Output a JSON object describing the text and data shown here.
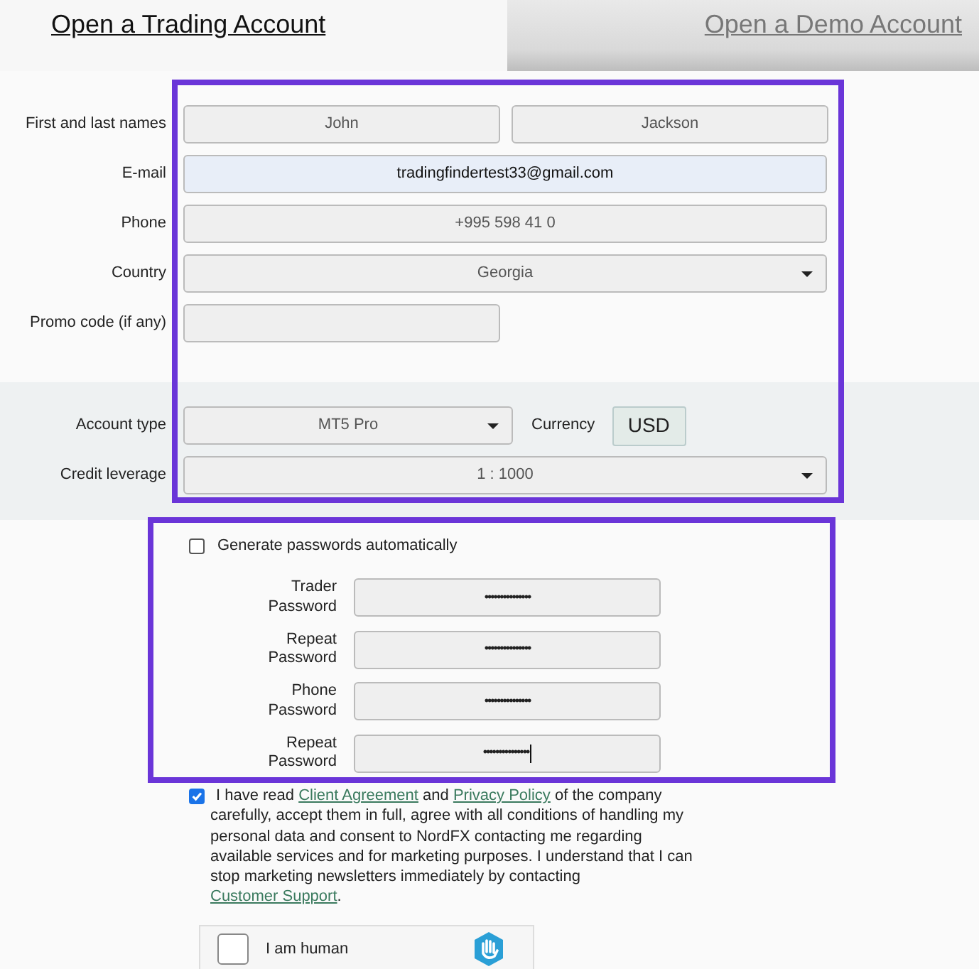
{
  "tabs": [
    {
      "label": "Open a Trading Account",
      "selected": true
    },
    {
      "label": "Open a Demo Account",
      "selected": false
    }
  ],
  "personal_fields": [
    {
      "kind": "pair",
      "label": "First and last names",
      "values": [
        "John",
        "Jackson"
      ]
    },
    {
      "kind": "text",
      "label": "E-mail",
      "value": "tradingfindertest33@gmail.com",
      "autofilled": true
    },
    {
      "kind": "text",
      "label": "Phone",
      "value": "+995 598 41 0"
    },
    {
      "kind": "select",
      "label": "Country",
      "value": "Georgia"
    },
    {
      "kind": "short",
      "label": "Promo code (if any)"
    }
  ],
  "account": {
    "account_type": {
      "label": "Account type",
      "value": "MT5 Pro"
    },
    "currency": {
      "label": "Currency",
      "value": "USD"
    },
    "leverage": {
      "label": "Credit leverage",
      "value": "1 : 1000"
    }
  },
  "passwords": {
    "generate": {
      "label": "Generate passwords automatically",
      "checked": false
    },
    "fields": [
      {
        "label": "Trader Password",
        "value": "•••••••••••••••",
        "cursor": false
      },
      {
        "label": "Repeat Password",
        "value": "•••••••••••••••",
        "cursor": false
      },
      {
        "label": "Phone Password",
        "value": "•••••••••••••••",
        "cursor": false
      },
      {
        "label": "Repeat Password",
        "value": "•••••••••••••••",
        "cursor": true
      }
    ]
  },
  "consent": {
    "checked": true,
    "parts": [
      {
        "kind": "text",
        "text": "I have read "
      },
      {
        "kind": "link",
        "text": "Client Agreement"
      },
      {
        "kind": "text",
        "text": " and "
      },
      {
        "kind": "link",
        "text": "Privacy Policy"
      },
      {
        "kind": "text",
        "text": " of the company carefully, accept them in full, agree with all conditions of handling my personal data and consent to NordFX contacting me regarding available services and for marketing purposes. I understand that I can stop marketing newsletters immediately by contacting "
      },
      {
        "kind": "link",
        "text": "Customer Support"
      },
      {
        "kind": "text",
        "text": "."
      }
    ]
  },
  "captcha": {
    "label": "I am human",
    "checked": false
  }
}
